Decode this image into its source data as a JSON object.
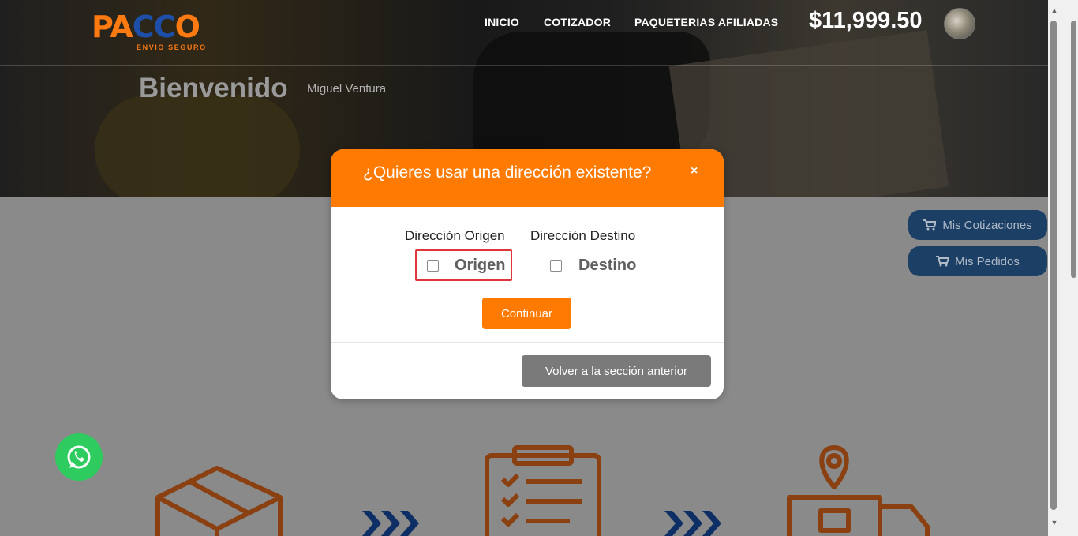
{
  "brand": {
    "logo_main_a": "PA",
    "logo_main_b": "CC",
    "logo_main_c": "O",
    "logo_sub": "ENVIO SEGURO"
  },
  "nav": {
    "inicio": "INICIO",
    "cotizador": "COTIZADOR",
    "paqueterias": "PAQUETERIAS AFILIADAS"
  },
  "account": {
    "balance": "$11,999.50"
  },
  "welcome": {
    "title": "Bienvenido",
    "user": "Miguel Ventura"
  },
  "side": {
    "cotizaciones": "Mis Cotizaciones",
    "pedidos": "Mis Pedidos"
  },
  "modal": {
    "title": "¿Quieres usar una dirección existente?",
    "close": "×",
    "origin_label": "Dirección Origen",
    "dest_label": "Dirección Destino",
    "origin_option": "Origen",
    "dest_option": "Destino",
    "continue": "Continuar",
    "back": "Volver a la sección anterior"
  },
  "colors": {
    "orange": "#ff7a00",
    "navy": "#1c3f66",
    "whatsapp": "#2ecc5e",
    "gray_button": "#7a7a7a"
  },
  "icons": [
    "cart-icon",
    "whatsapp-icon",
    "box-icon",
    "clipboard-icon",
    "truck-icon",
    "chevrons-icon"
  ]
}
